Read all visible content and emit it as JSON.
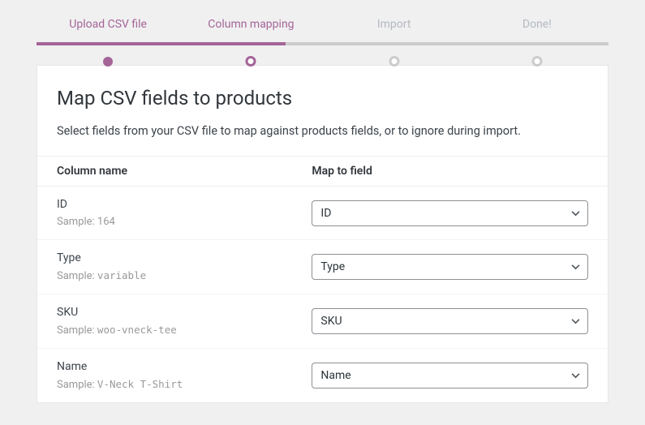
{
  "steps": [
    {
      "label": "Upload CSV file",
      "state": "done"
    },
    {
      "label": "Column mapping",
      "state": "active"
    },
    {
      "label": "Import",
      "state": "inactive"
    },
    {
      "label": "Done!",
      "state": "inactive"
    }
  ],
  "title": "Map CSV fields to products",
  "description": "Select fields from your CSV file to map against products fields, or to ignore during import.",
  "table": {
    "head_left": "Column name",
    "head_right": "Map to field",
    "sample_prefix": "Sample: ",
    "rows": [
      {
        "name": "ID",
        "sample": "164",
        "mono": false,
        "selected": "ID"
      },
      {
        "name": "Type",
        "sample": "variable",
        "mono": true,
        "selected": "Type"
      },
      {
        "name": "SKU",
        "sample": "woo-vneck-tee",
        "mono": true,
        "selected": "SKU"
      },
      {
        "name": "Name",
        "sample": "V-Neck T-Shirt",
        "mono": true,
        "selected": "Name"
      }
    ]
  },
  "colors": {
    "accent": "#a46497"
  }
}
